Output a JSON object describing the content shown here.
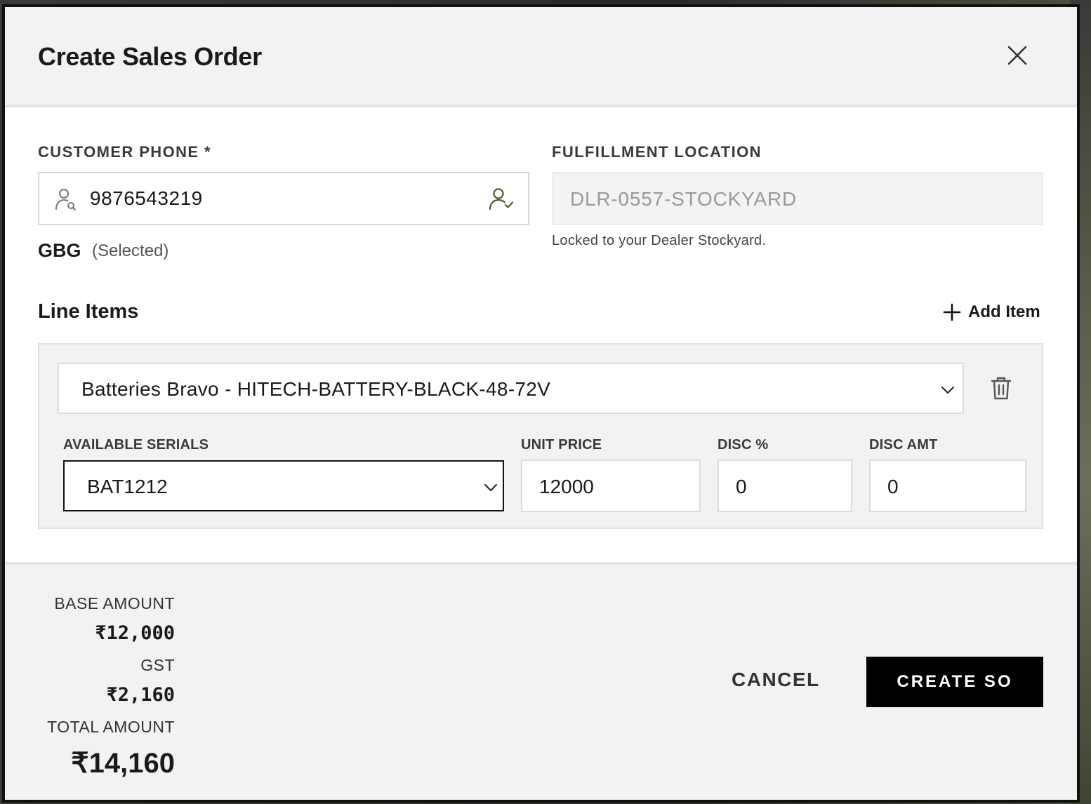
{
  "modal": {
    "title": "Create Sales Order"
  },
  "customer": {
    "label": "CUSTOMER PHONE *",
    "phone": "9876543219",
    "name": "GBG",
    "status": "(Selected)"
  },
  "fulfillment": {
    "label": "FULFILLMENT LOCATION",
    "value": "DLR-0557-STOCKYARD",
    "help": "Locked to your Dealer Stockyard."
  },
  "line_items": {
    "title": "Line Items",
    "add_label": "Add Item",
    "items": [
      {
        "product": "Batteries Bravo - HITECH-BATTERY-BLACK-48-72V",
        "serials_label": "AVAILABLE SERIALS",
        "serial": "BAT1212",
        "unit_price_label": "UNIT PRICE",
        "unit_price": "12000",
        "disc_pct_label": "DISC %",
        "disc_pct": "0",
        "disc_amt_label": "DISC AMT",
        "disc_amt": "0"
      }
    ]
  },
  "summary": {
    "base_label": "BASE AMOUNT",
    "base_value": "₹12,000",
    "gst_label": "GST",
    "gst_value": "₹2,160",
    "total_label": "TOTAL AMOUNT",
    "total_value": "₹14,160"
  },
  "actions": {
    "cancel": "CANCEL",
    "create": "CREATE SO"
  },
  "colors": {
    "primary_button": "#000000",
    "verified_icon": "#4a5a1e",
    "header_bg": "#f2f2f2"
  }
}
